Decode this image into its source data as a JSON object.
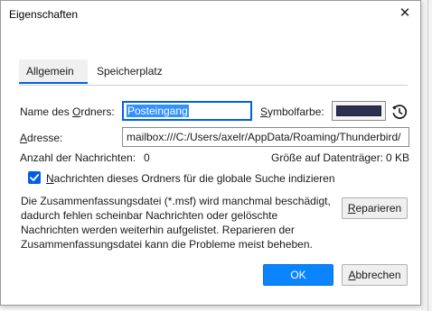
{
  "window": {
    "title": "Eigenschaften",
    "close_glyph": "✕"
  },
  "tabs": [
    {
      "label": "Allgemein",
      "active": true
    },
    {
      "label": "Speicherplatz",
      "active": false
    }
  ],
  "form": {
    "folder_name_label": "Name des Ordners:",
    "folder_name_value": "Posteingang",
    "icon_color_label": "Symbolfarbe:",
    "icon_color_value": "#2c3050",
    "address_label": "Adresse:",
    "address_value": "mailbox:///C:/Users/axelr/AppData/Roaming/Thunderbird/",
    "message_count_label": "Anzahl der Nachrichten:",
    "message_count_value": "0",
    "disk_size_label": "Größe auf Datenträger:",
    "disk_size_value": "0 KB",
    "global_search_checkbox_label": "Nachrichten dieses Ordners für die globale Suche indizieren",
    "global_search_checked": true
  },
  "repair": {
    "description_lines": [
      "Die Zusammenfassungsdatei (*.msf) wird manchmal beschädigt,",
      "dadurch fehlen scheinbar Nachrichten oder gelöschte",
      "Nachrichten werden weiterhin aufgelistet. Reparieren der",
      "Zusammenfassungsdatei kann die Probleme meist beheben."
    ],
    "button_label": "Reparieren"
  },
  "footer": {
    "ok_label": "OK",
    "cancel_label": "Abbrechen"
  },
  "icons": {
    "reset": "reset-color-icon",
    "check": "checkmark-icon",
    "close": "close-icon"
  }
}
